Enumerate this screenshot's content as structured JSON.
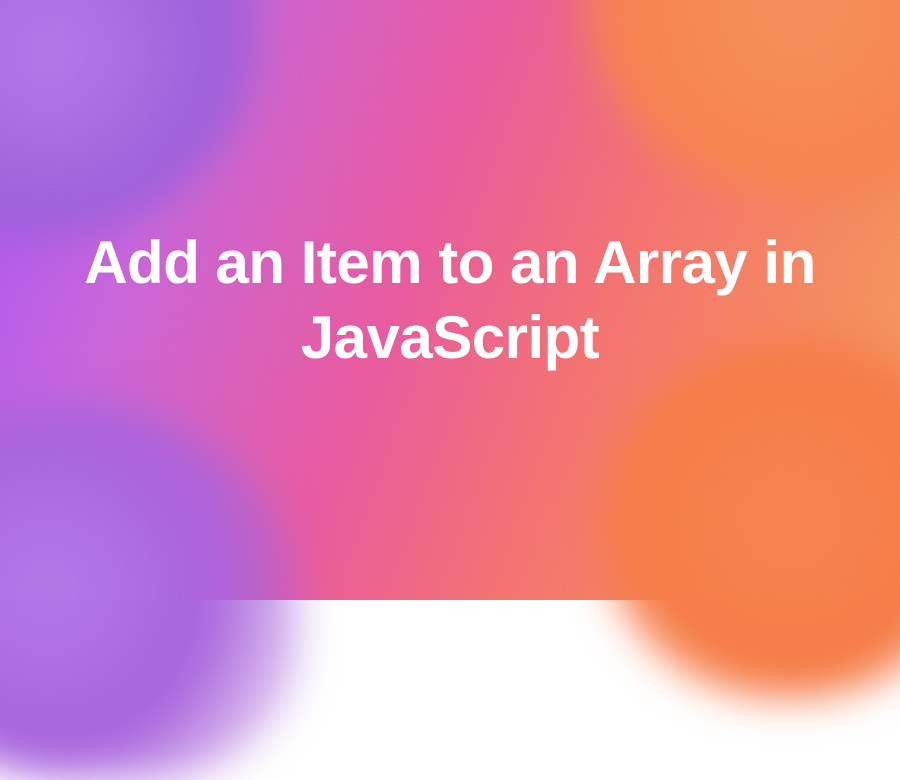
{
  "title": "Add an Item to an Array in JavaScript",
  "colors": {
    "purple": "#a855f7",
    "pink": "#e85a9e",
    "coral": "#f4736e",
    "orange": "#f59e5a",
    "text": "#ffffff"
  }
}
